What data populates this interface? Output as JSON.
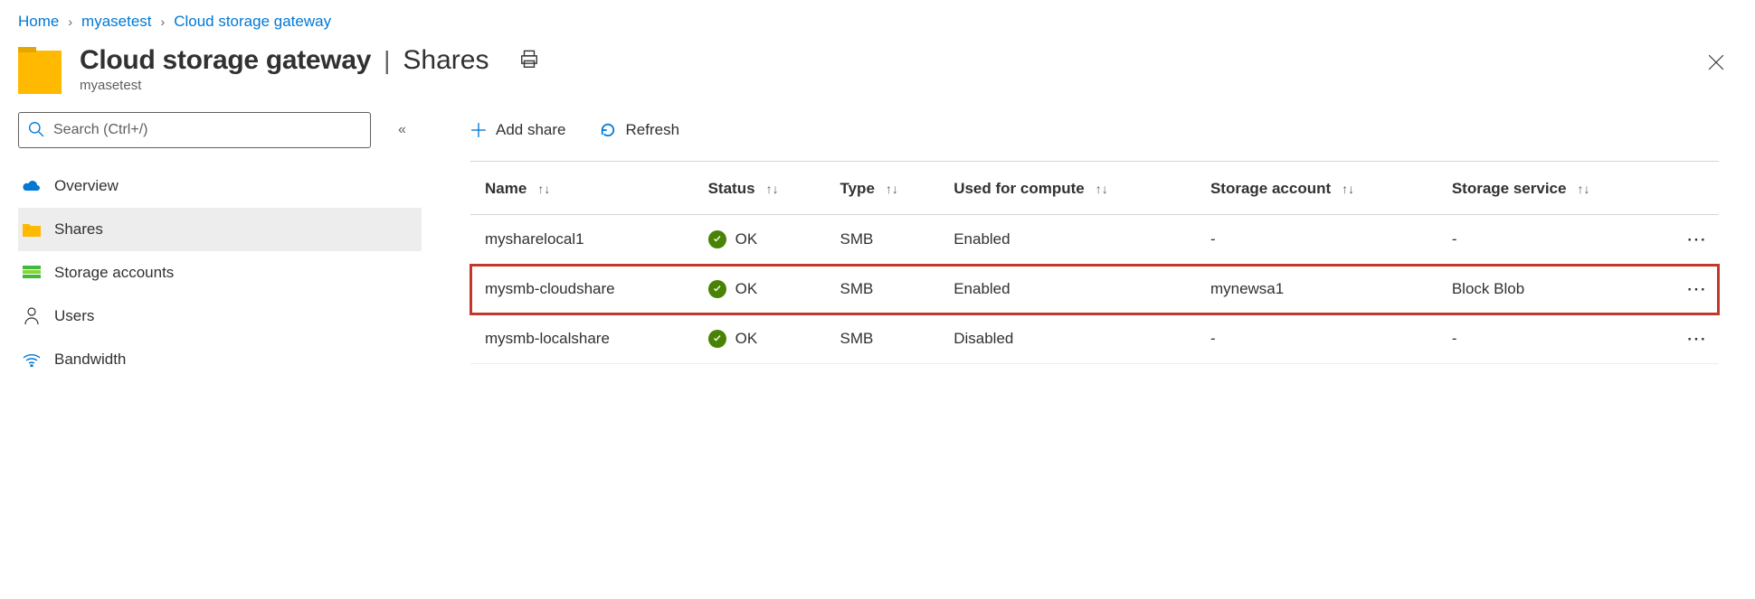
{
  "breadcrumb": {
    "home": "Home",
    "item1": "myasetest",
    "item2": "Cloud storage gateway"
  },
  "header": {
    "title": "Cloud storage gateway",
    "section": "Shares",
    "subtitle": "myasetest"
  },
  "sidebar": {
    "search_placeholder": "Search (Ctrl+/)",
    "items": {
      "overview": "Overview",
      "shares": "Shares",
      "storage": "Storage accounts",
      "users": "Users",
      "bandwidth": "Bandwidth"
    }
  },
  "toolbar": {
    "add": "Add share",
    "refresh": "Refresh"
  },
  "table": {
    "columns": {
      "name": "Name",
      "status": "Status",
      "type": "Type",
      "compute": "Used for compute",
      "account": "Storage account",
      "service": "Storage service"
    },
    "rows": [
      {
        "name": "mysharelocal1",
        "status": "OK",
        "type": "SMB",
        "compute": "Enabled",
        "account": "-",
        "service": "-",
        "hl": false
      },
      {
        "name": "mysmb-cloudshare",
        "status": "OK",
        "type": "SMB",
        "compute": "Enabled",
        "account": "mynewsa1",
        "service": "Block Blob",
        "hl": true
      },
      {
        "name": "mysmb-localshare",
        "status": "OK",
        "type": "SMB",
        "compute": "Disabled",
        "account": "-",
        "service": "-",
        "hl": false
      }
    ]
  }
}
